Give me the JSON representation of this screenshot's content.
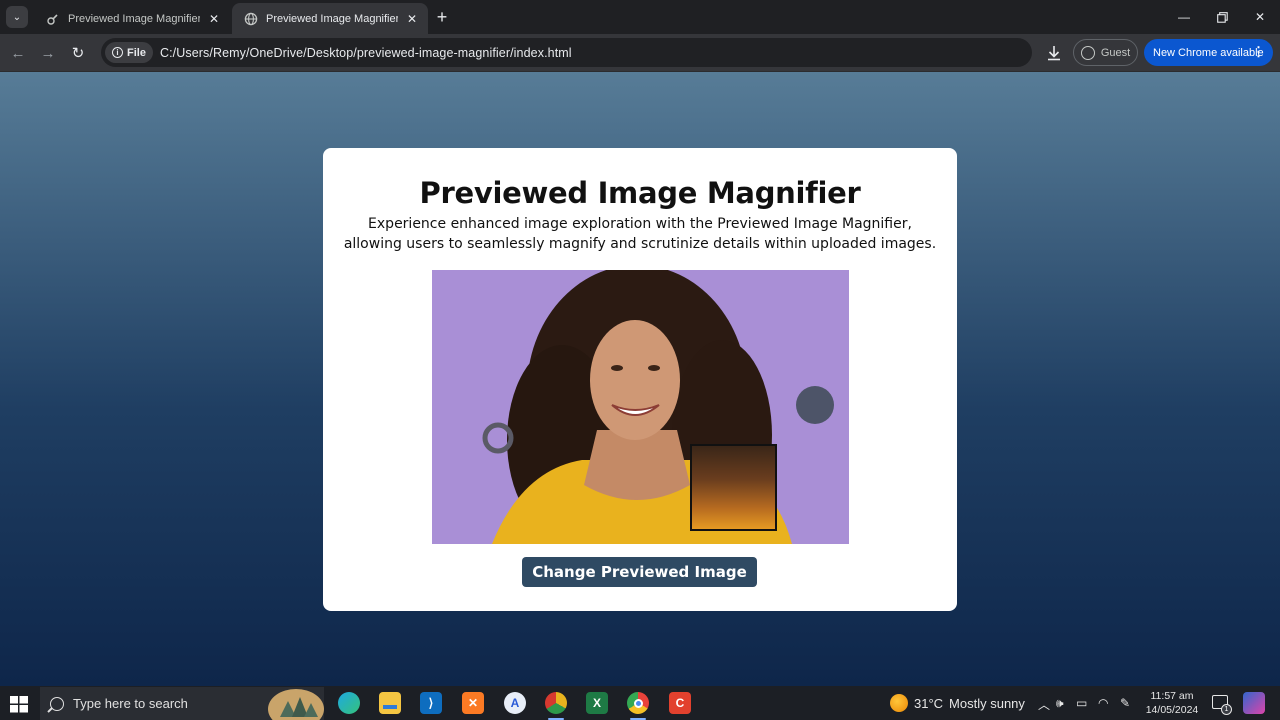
{
  "browser": {
    "tabs": [
      {
        "title": "Previewed Image Magnifier Usi",
        "active": false
      },
      {
        "title": "Previewed Image Magnifier",
        "active": true
      }
    ],
    "address": {
      "chip_label": "File",
      "url": "C:/Users/Remy/OneDrive/Desktop/previewed-image-magnifier/index.html"
    },
    "profile_label": "Guest",
    "update_label": "New Chrome available"
  },
  "page": {
    "title": "Previewed Image Magnifier",
    "description": "Experience enhanced image exploration with the Previewed Image Magnifier, allowing users to seamlessly magnify and scrutinize details within uploaded images.",
    "button_label": "Change Previewed Image"
  },
  "taskbar": {
    "search_placeholder": "Type here to search",
    "weather": {
      "temperature": "31°C",
      "condition": "Mostly sunny"
    },
    "clock": {
      "time": "11:57 am",
      "date": "14/05/2024"
    },
    "notification_count": "1",
    "apps": [
      "edge-icon",
      "file-explorer-icon",
      "vscode-icon",
      "xampp-icon",
      "app-a-icon",
      "chrome-canary-icon",
      "excel-icon",
      "chrome-icon",
      "canva-icon"
    ]
  },
  "colors": {
    "accent_button": "#2f4a63",
    "update_pill": "#0b57d0",
    "preview_background": "#a98fd6"
  }
}
